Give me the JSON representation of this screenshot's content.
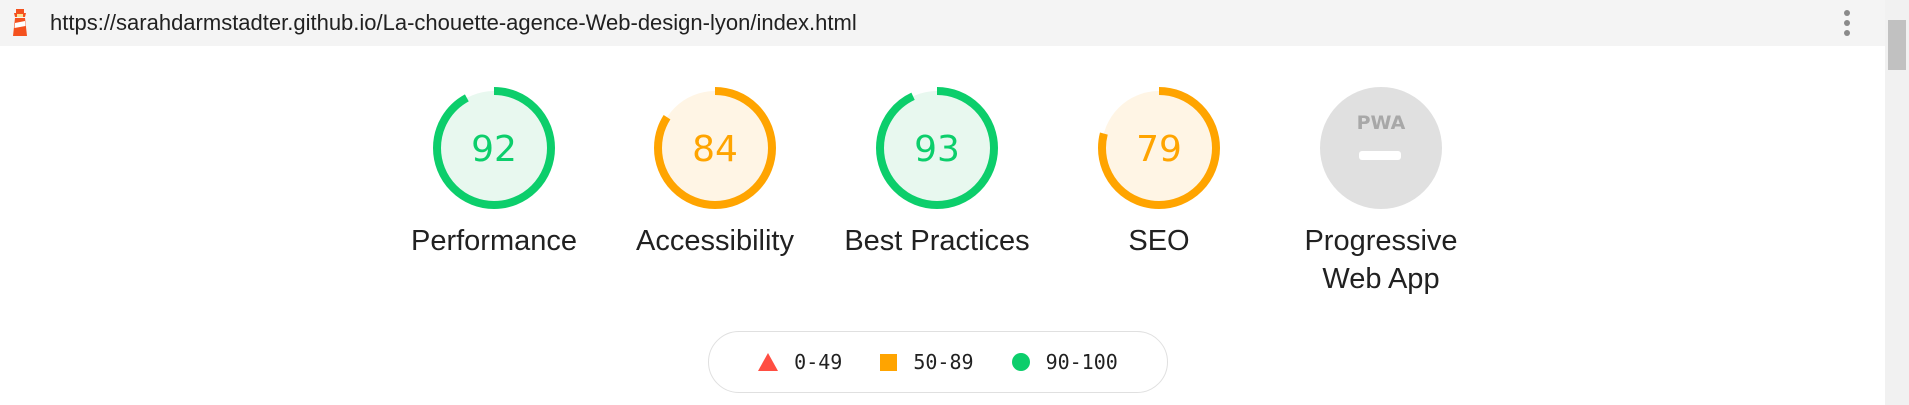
{
  "browser": {
    "url": "https://sarahdarmstadter.github.io/La-chouette-agence-Web-design-lyon/index.html",
    "logo_icon": "lighthouse-icon",
    "menu_icon": "more-vertical-icon"
  },
  "gauges": [
    {
      "score": "92",
      "value": 92,
      "label": "Performance",
      "color": "#0cce6b",
      "bg": "#e8f8ef"
    },
    {
      "score": "84",
      "value": 84,
      "label": "Accessibility",
      "color": "#ffa400",
      "bg": "#fff5e5"
    },
    {
      "score": "93",
      "value": 93,
      "label": "Best Practices",
      "color": "#0cce6b",
      "bg": "#e8f8ef"
    },
    {
      "score": "79",
      "value": 79,
      "label": "SEO",
      "color": "#ffa400",
      "bg": "#fff5e5"
    }
  ],
  "pwa": {
    "badge": "PWA",
    "label_line1": "Progressive",
    "label_line2": "Web App",
    "color": "#e0e0e0"
  },
  "legend": {
    "fail": "0-49",
    "average": "50-89",
    "pass": "90-100",
    "fail_color": "#ff4e42",
    "average_color": "#ffa400",
    "pass_color": "#0cce6b"
  }
}
